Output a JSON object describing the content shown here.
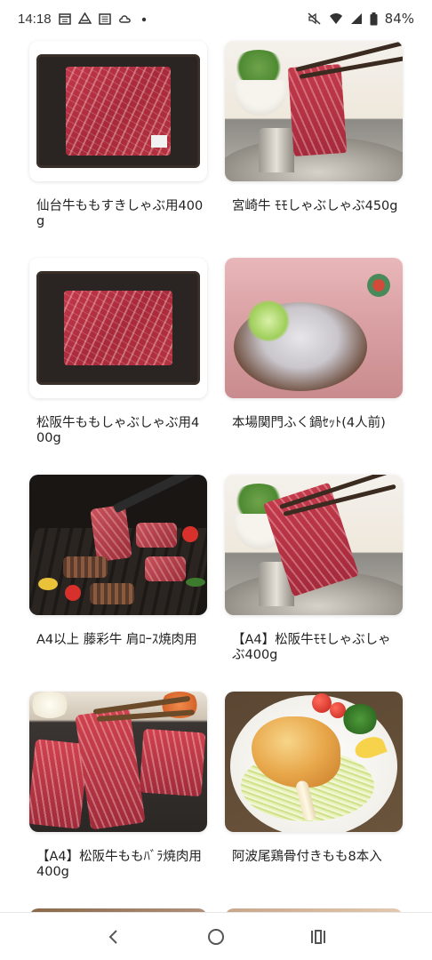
{
  "status_bar": {
    "time": "14:18",
    "battery": "84%",
    "icons_left": [
      "calendar-icon",
      "drive-icon",
      "news-icon",
      "cloud-icon",
      "dot-icon"
    ],
    "icons_right": [
      "mute-icon",
      "wifi-icon",
      "signal-icon",
      "battery-icon"
    ]
  },
  "products": [
    {
      "name": "仙台牛ももすきしゃぶ用400g",
      "image": "beef-tray"
    },
    {
      "name": "宮崎牛 ﾓﾓしゃぶしゃぶ450g",
      "image": "shabu"
    },
    {
      "name": "松阪牛ももしゃぶしゃぶ用400g",
      "image": "beef-tray"
    },
    {
      "name": "本場関門ふく鍋ｾｯﾄ(4人前)",
      "image": "fugu-nabe"
    },
    {
      "name": "A4以上 藤彩牛 肩ﾛｰｽ焼肉用",
      "image": "grill"
    },
    {
      "name": "【A4】松阪牛ﾓﾓしゃぶしゃぶ400g",
      "image": "shabu"
    },
    {
      "name": "【A4】松阪牛ももﾊﾞﾗ焼肉用400g",
      "image": "yakiniku"
    },
    {
      "name": "阿波尾鶏骨付きもも8本入",
      "image": "chicken"
    }
  ],
  "nav_bar": {
    "back": "back-icon",
    "home": "home-icon",
    "recents": "recents-icon"
  }
}
